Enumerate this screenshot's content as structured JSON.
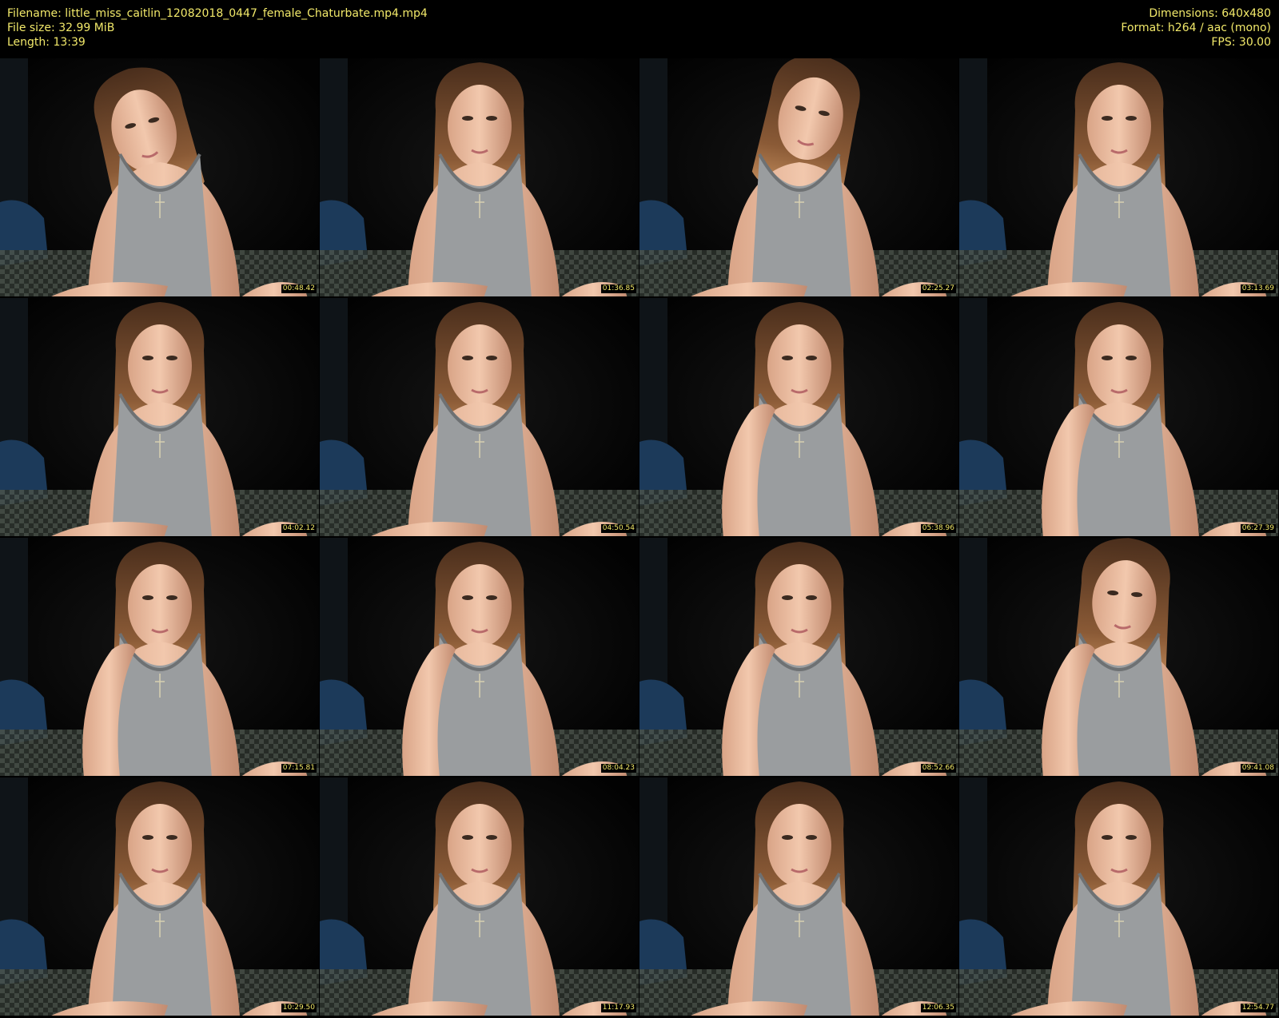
{
  "header": {
    "filename": "Filename: little_miss_caitlin_12082018_0447_female_Chaturbate.mp4.mp4",
    "file_size": "File size: 32.99 MiB",
    "length": "Length: 13:39",
    "dimensions": "Dimensions: 640x480",
    "format": "Format: h264 / aac (mono)",
    "fps": "FPS: 30.00"
  },
  "colors": {
    "text": "#f2e96a",
    "background": "#000000"
  },
  "thumbnails": [
    {
      "timestamp": "00:48.42",
      "pose": "head-tilted-down"
    },
    {
      "timestamp": "01:36.85",
      "pose": "facing-camera"
    },
    {
      "timestamp": "02:25.27",
      "pose": "head-tilted-back"
    },
    {
      "timestamp": "03:13.69",
      "pose": "facing-camera"
    },
    {
      "timestamp": "04:02.12",
      "pose": "facing-camera"
    },
    {
      "timestamp": "04:50.54",
      "pose": "facing-camera"
    },
    {
      "timestamp": "05:38.96",
      "pose": "hand-on-chin"
    },
    {
      "timestamp": "06:27.39",
      "pose": "hand-on-chin"
    },
    {
      "timestamp": "07:15.81",
      "pose": "hand-on-neck"
    },
    {
      "timestamp": "08:04.23",
      "pose": "hand-on-neck"
    },
    {
      "timestamp": "08:52.66",
      "pose": "hand-on-chin"
    },
    {
      "timestamp": "09:41.08",
      "pose": "hand-at-mouth"
    },
    {
      "timestamp": "10:29.50",
      "pose": "facing-camera"
    },
    {
      "timestamp": "11:17.93",
      "pose": "facing-camera"
    },
    {
      "timestamp": "12:06.35",
      "pose": "facing-camera"
    },
    {
      "timestamp": "12:54.77",
      "pose": "facing-camera"
    }
  ]
}
